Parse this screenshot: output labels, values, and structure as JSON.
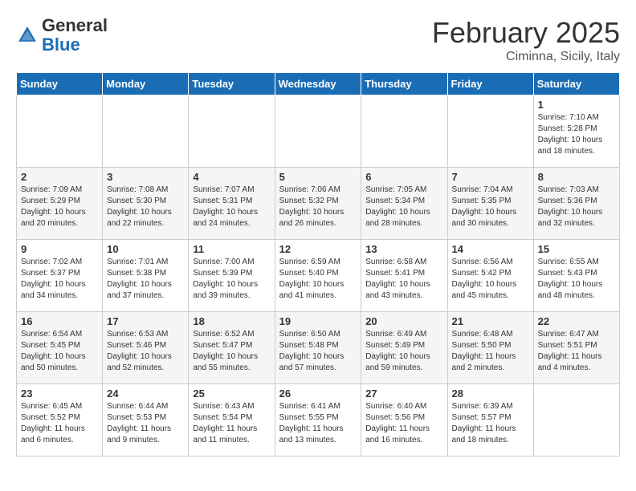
{
  "header": {
    "logo_general": "General",
    "logo_blue": "Blue",
    "month_year": "February 2025",
    "location": "Ciminna, Sicily, Italy"
  },
  "weekdays": [
    "Sunday",
    "Monday",
    "Tuesday",
    "Wednesday",
    "Thursday",
    "Friday",
    "Saturday"
  ],
  "weeks": [
    [
      {
        "day": "",
        "detail": ""
      },
      {
        "day": "",
        "detail": ""
      },
      {
        "day": "",
        "detail": ""
      },
      {
        "day": "",
        "detail": ""
      },
      {
        "day": "",
        "detail": ""
      },
      {
        "day": "",
        "detail": ""
      },
      {
        "day": "1",
        "detail": "Sunrise: 7:10 AM\nSunset: 5:28 PM\nDaylight: 10 hours\nand 18 minutes."
      }
    ],
    [
      {
        "day": "2",
        "detail": "Sunrise: 7:09 AM\nSunset: 5:29 PM\nDaylight: 10 hours\nand 20 minutes."
      },
      {
        "day": "3",
        "detail": "Sunrise: 7:08 AM\nSunset: 5:30 PM\nDaylight: 10 hours\nand 22 minutes."
      },
      {
        "day": "4",
        "detail": "Sunrise: 7:07 AM\nSunset: 5:31 PM\nDaylight: 10 hours\nand 24 minutes."
      },
      {
        "day": "5",
        "detail": "Sunrise: 7:06 AM\nSunset: 5:32 PM\nDaylight: 10 hours\nand 26 minutes."
      },
      {
        "day": "6",
        "detail": "Sunrise: 7:05 AM\nSunset: 5:34 PM\nDaylight: 10 hours\nand 28 minutes."
      },
      {
        "day": "7",
        "detail": "Sunrise: 7:04 AM\nSunset: 5:35 PM\nDaylight: 10 hours\nand 30 minutes."
      },
      {
        "day": "8",
        "detail": "Sunrise: 7:03 AM\nSunset: 5:36 PM\nDaylight: 10 hours\nand 32 minutes."
      }
    ],
    [
      {
        "day": "9",
        "detail": "Sunrise: 7:02 AM\nSunset: 5:37 PM\nDaylight: 10 hours\nand 34 minutes."
      },
      {
        "day": "10",
        "detail": "Sunrise: 7:01 AM\nSunset: 5:38 PM\nDaylight: 10 hours\nand 37 minutes."
      },
      {
        "day": "11",
        "detail": "Sunrise: 7:00 AM\nSunset: 5:39 PM\nDaylight: 10 hours\nand 39 minutes."
      },
      {
        "day": "12",
        "detail": "Sunrise: 6:59 AM\nSunset: 5:40 PM\nDaylight: 10 hours\nand 41 minutes."
      },
      {
        "day": "13",
        "detail": "Sunrise: 6:58 AM\nSunset: 5:41 PM\nDaylight: 10 hours\nand 43 minutes."
      },
      {
        "day": "14",
        "detail": "Sunrise: 6:56 AM\nSunset: 5:42 PM\nDaylight: 10 hours\nand 45 minutes."
      },
      {
        "day": "15",
        "detail": "Sunrise: 6:55 AM\nSunset: 5:43 PM\nDaylight: 10 hours\nand 48 minutes."
      }
    ],
    [
      {
        "day": "16",
        "detail": "Sunrise: 6:54 AM\nSunset: 5:45 PM\nDaylight: 10 hours\nand 50 minutes."
      },
      {
        "day": "17",
        "detail": "Sunrise: 6:53 AM\nSunset: 5:46 PM\nDaylight: 10 hours\nand 52 minutes."
      },
      {
        "day": "18",
        "detail": "Sunrise: 6:52 AM\nSunset: 5:47 PM\nDaylight: 10 hours\nand 55 minutes."
      },
      {
        "day": "19",
        "detail": "Sunrise: 6:50 AM\nSunset: 5:48 PM\nDaylight: 10 hours\nand 57 minutes."
      },
      {
        "day": "20",
        "detail": "Sunrise: 6:49 AM\nSunset: 5:49 PM\nDaylight: 10 hours\nand 59 minutes."
      },
      {
        "day": "21",
        "detail": "Sunrise: 6:48 AM\nSunset: 5:50 PM\nDaylight: 11 hours\nand 2 minutes."
      },
      {
        "day": "22",
        "detail": "Sunrise: 6:47 AM\nSunset: 5:51 PM\nDaylight: 11 hours\nand 4 minutes."
      }
    ],
    [
      {
        "day": "23",
        "detail": "Sunrise: 6:45 AM\nSunset: 5:52 PM\nDaylight: 11 hours\nand 6 minutes."
      },
      {
        "day": "24",
        "detail": "Sunrise: 6:44 AM\nSunset: 5:53 PM\nDaylight: 11 hours\nand 9 minutes."
      },
      {
        "day": "25",
        "detail": "Sunrise: 6:43 AM\nSunset: 5:54 PM\nDaylight: 11 hours\nand 11 minutes."
      },
      {
        "day": "26",
        "detail": "Sunrise: 6:41 AM\nSunset: 5:55 PM\nDaylight: 11 hours\nand 13 minutes."
      },
      {
        "day": "27",
        "detail": "Sunrise: 6:40 AM\nSunset: 5:56 PM\nDaylight: 11 hours\nand 16 minutes."
      },
      {
        "day": "28",
        "detail": "Sunrise: 6:39 AM\nSunset: 5:57 PM\nDaylight: 11 hours\nand 18 minutes."
      },
      {
        "day": "",
        "detail": ""
      }
    ]
  ]
}
